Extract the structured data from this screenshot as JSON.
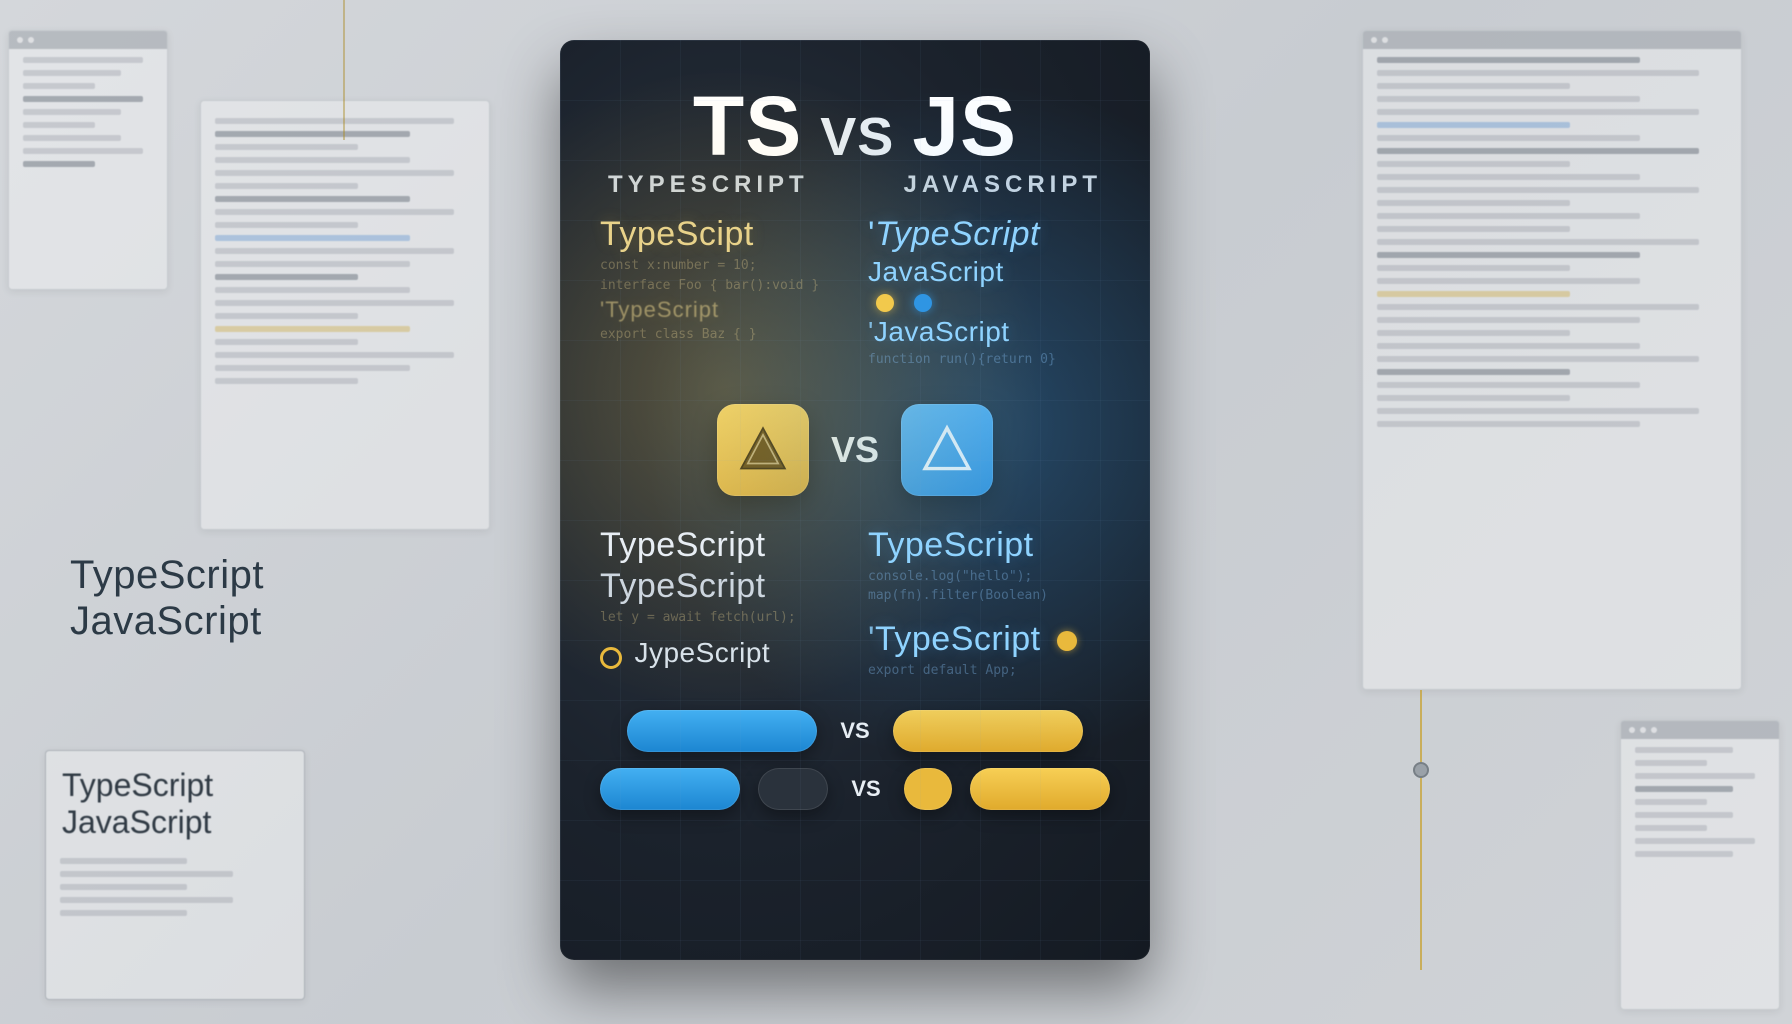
{
  "headline": {
    "left": "TS",
    "mid": "VS",
    "right": "JS"
  },
  "subhead": {
    "left": "TYPESCRIPT",
    "right": "JAVASCRIPT"
  },
  "colors": {
    "ts_accent": "#f2c94c",
    "js_accent": "#2f95e3",
    "card_bg": "#1b222c"
  },
  "left_col": {
    "w1": "TypeScipt",
    "w2": "TypeScript",
    "w3": "TypeScript",
    "w4": "JypeScript"
  },
  "right_col": {
    "w1": "TypeScript",
    "w2": "JavaScript",
    "w3": "JavaScript",
    "w4": "TypeScript",
    "w5": "TypeScript"
  },
  "logo_row": {
    "vs": "VS"
  },
  "pill_rows": {
    "r1_vs": "VS",
    "r2_vs": "VS"
  },
  "side_label": {
    "line1": "TypeScript",
    "line2": "JavaScript"
  },
  "small_card": {
    "line1": "TypeScript",
    "line2": "JavaScript"
  }
}
